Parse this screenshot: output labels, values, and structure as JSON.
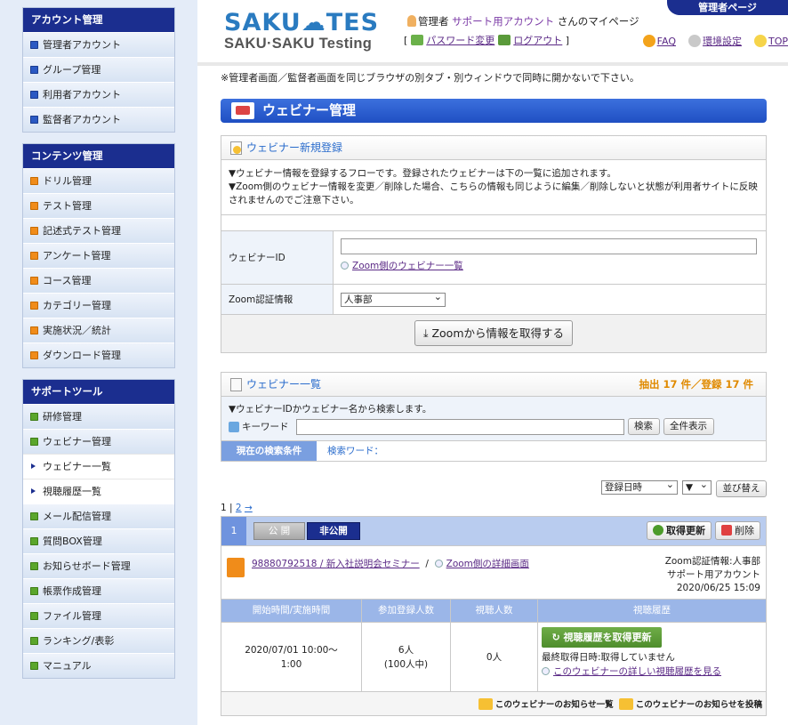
{
  "sidebar": {
    "account": {
      "header": "アカウント管理",
      "items": [
        "管理者アカウント",
        "グループ管理",
        "利用者アカウント",
        "監督者アカウント"
      ]
    },
    "content": {
      "header": "コンテンツ管理",
      "items": [
        "ドリル管理",
        "テスト管理",
        "記述式テスト管理",
        "アンケート管理",
        "コース管理",
        "カテゴリー管理",
        "実施状況／統計",
        "ダウンロード管理"
      ]
    },
    "support": {
      "header": "サポートツール",
      "items": [
        "研修管理",
        "ウェビナー管理",
        "ウェビナー一覧",
        "視聴履歴一覧",
        "メール配信管理",
        "質問BOX管理",
        "お知らせボード管理",
        "帳票作成管理",
        "ファイル管理",
        "ランキング/表彰",
        "マニュアル"
      ]
    }
  },
  "header": {
    "logo_line1": "SAKU☁TES",
    "logo_line2": "SAKU·SAKU Testing",
    "admin_tag": "管理者ページ",
    "user_prefix": "管理者",
    "user_name": "サポート用アカウント",
    "user_suffix": "さんのマイページ",
    "bracket_open": "[",
    "bracket_close": "]",
    "password_link": "パスワード変更",
    "logout_link": "ログアウト",
    "faq": "FAQ",
    "settings": "環境設定",
    "top": "TOP"
  },
  "warning": "※管理者画面／監督者画面を同じブラウザの別タブ・別ウィンドウで同時に開かないで下さい。",
  "page_title": "ウェビナー管理",
  "register": {
    "title": "ウェビナー新規登録",
    "note1": "▼ウェビナー情報を登録するフローです。登録されたウェビナーは下の一覧に追加されます。",
    "note2": "▼Zoom側のウェビナー情報を変更／削除した場合、こちらの情報も同じように編集／削除しないと状態が利用者サイトに反映されませんのでご注意下さい。",
    "webinar_id_label": "ウェビナーID",
    "webinar_id_value": "",
    "zoom_list_link": "Zoom側のウェビナー一覧",
    "auth_label": "Zoom認証情報",
    "auth_value": "人事部",
    "fetch_button": "Zoomから情報を取得する"
  },
  "list": {
    "title": "ウェビナー一覧",
    "count": "抽出 17 件／登録 17 件",
    "search_note": "▼ウェビナーIDかウェビナー名から検索します。",
    "keyword_label": "キーワード",
    "keyword_value": "",
    "search_button": "検索",
    "show_all_button": "全件表示",
    "cond_label": "現在の検索条件",
    "cond_value": "検索ワード：",
    "sort_field": "登録日時",
    "sort_order": "▼",
    "sort_button": "並び替え",
    "pager_current": "1",
    "pager_sep": "|",
    "pager_next": "2",
    "pager_arrow": "→"
  },
  "record": {
    "num": "1",
    "public_label": "公 開",
    "private_label": "非公開",
    "refresh_button": "取得更新",
    "delete_button": "削除",
    "webinar_link": "98880792518 / 新入社説明会セミナー",
    "slash": "/",
    "zoom_detail_link": "Zoom側の詳細画面",
    "auth_info": "Zoom認証情報:人事部",
    "account": "サポート用アカウント",
    "date": "2020/06/25 15:09",
    "headers": [
      "開始時間/実施時間",
      "参加登録人数",
      "視聴人数",
      "視聴履歴"
    ],
    "start_line1": "2020/07/01 10:00〜",
    "start_line2": "1:00",
    "reg_count": "6人",
    "reg_cap": "(100人中)",
    "view_count": "0人",
    "history_button": "視聴履歴を取得更新",
    "last_fetch": "最終取得日時:取得していません",
    "history_link": "このウェビナーの詳しい視聴履歴を見る",
    "notice_list": "このウェビナーのお知らせ一覧",
    "notice_post": "このウェビナーのお知らせを投稿"
  }
}
